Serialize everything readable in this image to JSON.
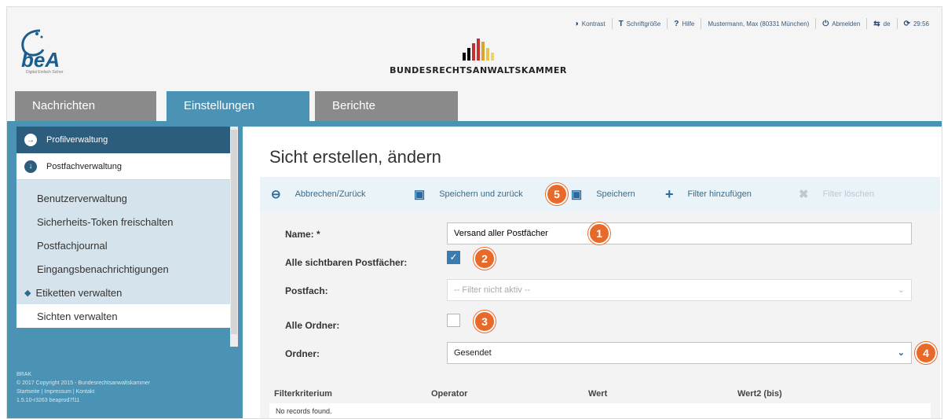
{
  "header": {
    "logo_text": "beA",
    "logo_tagline": "Digital Einfach Sicher",
    "org_name": "BUNDESRECHTSANWALTSKAMMER",
    "util": {
      "kontrast": "Kontrast",
      "schriftgroesse": "Schriftgröße",
      "hilfe": "Hilfe",
      "user": "Mustermann, Max (80331 München)",
      "abmelden": "Abmelden",
      "lang": "de",
      "timer": "29:56"
    }
  },
  "tabs": {
    "nachrichten": "Nachrichten",
    "einstellungen": "Einstellungen",
    "berichte": "Berichte"
  },
  "sidebar": {
    "profilverwaltung": "Profilverwaltung",
    "postfachverwaltung": "Postfachverwaltung",
    "items": [
      "Benutzerverwaltung",
      "Sicherheits-Token freischalten",
      "Postfachjournal",
      "Eingangsbenachrichtigungen",
      "Etiketten verwalten",
      "Sichten verwalten"
    ],
    "footer_brak": "BRAK",
    "footer_copyright": "© 2017 Copyright 2015 - Bundesrechtsanwaltskammer",
    "footer_links": "Startseite | Impressum | Kontakt",
    "footer_version": "1.5.10-r3263 beaprod7f11"
  },
  "main": {
    "title": "Sicht erstellen, ändern",
    "toolbar": {
      "back": "Abbrechen/Zurück",
      "save_back": "Speichern und zurück",
      "save": "Speichern",
      "add_filter": "Filter hinzufügen",
      "delete_filter": "Filter löschen"
    },
    "form": {
      "name_label": "Name: *",
      "name_value": "Versand aller Postfächer",
      "all_mailboxes_label": "Alle sichtbaren Postfächer:",
      "all_mailboxes_checked": true,
      "postfach_label": "Postfach:",
      "postfach_value": "-- Filter nicht aktiv --",
      "all_folders_label": "Alle Ordner:",
      "all_folders_checked": false,
      "ordner_label": "Ordner:",
      "ordner_value": "Gesendet"
    },
    "table": {
      "columns": [
        "Filterkriterium",
        "Operator",
        "Wert",
        "Wert2 (bis)"
      ],
      "empty_text": "No records found."
    },
    "badges": [
      "1",
      "2",
      "3",
      "4",
      "5"
    ]
  },
  "colors": {
    "tab_active": "#4a93b5",
    "sidebar_dark": "#2d5d7c",
    "badge": "#e86a2a"
  }
}
